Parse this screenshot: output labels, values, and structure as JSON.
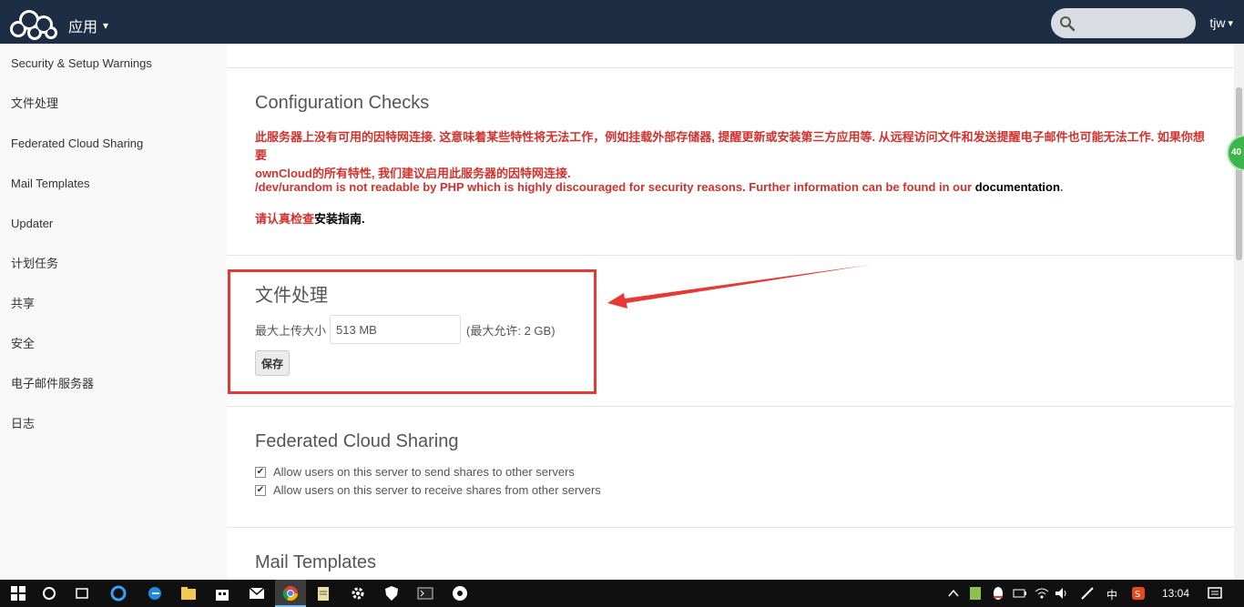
{
  "header": {
    "apps_label": "应用",
    "caret": "▾",
    "search_placeholder": "",
    "user": "tjw",
    "colors": {
      "bg": "#1d2d44",
      "search": "#d9dde2"
    }
  },
  "sidebar": {
    "items": [
      "Security & Setup Warnings",
      "文件处理",
      "Federated Cloud Sharing",
      "Mail Templates",
      "Updater",
      "计划任务",
      "共享",
      "安全",
      "电子邮件服务器",
      "日志"
    ]
  },
  "checks": {
    "title": "Configuration Checks",
    "warning1_line1": "此服务器上没有可用的因特网连接. 这意味着某些特性将无法工作，例如挂载外部存储器, 提醒更新或安装第三方应用等. 从远程访问文件和发送提醒电子邮件也可能无法工作. 如果你想要",
    "warning1_line2": "ownCloud的所有特性, 我们建议启用此服务器的因特网连接.",
    "warning2_text": "/dev/urandom is not readable by PHP which is highly discouraged for security reasons. Further information can be found in our ",
    "warning2_link": "documentation",
    "warning2_end": ".",
    "warning3_text": "请认真检查",
    "warning3_link": "安装指南",
    "warning3_end": "."
  },
  "file_handling": {
    "title": "文件处理",
    "max_upload_label": "最大上传大小",
    "max_upload_value": "513 MB",
    "max_allowed": "(最大允许: 2 GB)",
    "save_label": "保存"
  },
  "federated": {
    "title": "Federated Cloud Sharing",
    "option_send": "Allow users on this server to send shares to other servers",
    "option_receive": "Allow users on this server to receive shares from other servers",
    "send_checked": true,
    "receive_checked": true
  },
  "mail": {
    "title": "Mail Templates"
  },
  "widget": {
    "label": "40"
  },
  "taskbar": {
    "time": "13:04",
    "ime": "中",
    "icons": [
      "windows-start-icon",
      "cortana-icon",
      "task-view-icon",
      "ie-icon",
      "edge-icon",
      "file-explorer-icon",
      "store-icon",
      "mail-icon",
      "chrome-icon",
      "notepad-icon",
      "settings-icon",
      "security-icon",
      "cmd-icon",
      "app-icon"
    ]
  },
  "annotation": {
    "color": "#e53935"
  }
}
